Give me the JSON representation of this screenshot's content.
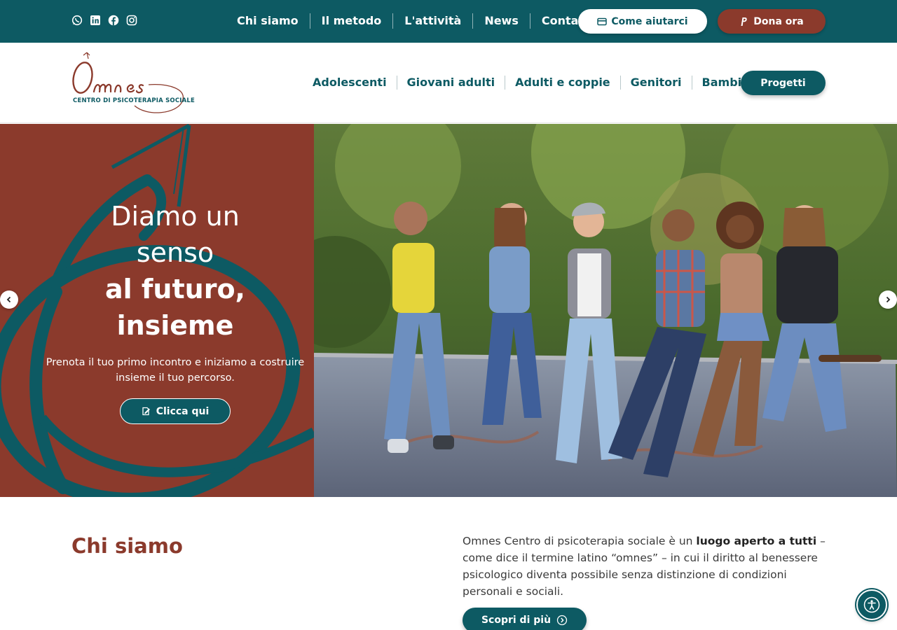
{
  "topbar": {
    "social": [
      {
        "name": "whatsapp-icon"
      },
      {
        "name": "linkedin-icon"
      },
      {
        "name": "facebook-icon"
      },
      {
        "name": "instagram-icon"
      }
    ],
    "nav": [
      "Chi siamo",
      "Il metodo",
      "L'attività",
      "News",
      "Contatti"
    ],
    "help_label": "Come aiutarci",
    "donate_label": "Dona ora"
  },
  "header": {
    "logo_name": "Omnes",
    "logo_subtitle": "CENTRO DI PSICOTERAPIA SOCIALE",
    "nav": [
      "Adolescenti",
      "Giovani adulti",
      "Adulti e coppie",
      "Genitori",
      "Bambini"
    ],
    "projects_label": "Progetti"
  },
  "hero": {
    "title_lines": [
      "Diamo un",
      "senso"
    ],
    "title_bold_lines": [
      "al futuro,",
      "insieme"
    ],
    "subtitle": "Prenota il tuo primo incontro e iniziamo a costruire insieme il tuo percorso.",
    "cta_label": "Clicca qui"
  },
  "about": {
    "title": "Chi siamo",
    "text_before": "Omnes Centro di psicoterapia sociale è un ",
    "text_bold": "luogo aperto a tutti",
    "text_after": " – come dice il termine latino “omnes” – in cui il diritto al benessere psicologico diventa possibile senza distinzione di condizioni personali e sociali.",
    "cta_label": "Scopri di più"
  },
  "colors": {
    "teal": "#0d5a63",
    "brick": "#8b3a2c",
    "white": "#ffffff"
  }
}
